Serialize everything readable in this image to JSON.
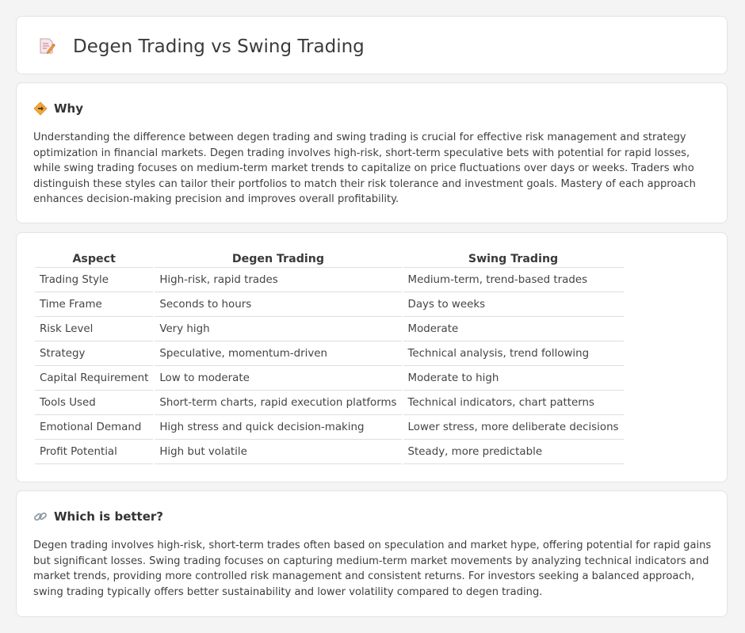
{
  "header": {
    "title": "Degen Trading vs Swing Trading",
    "icon": "memo-pencil-icon"
  },
  "why": {
    "heading": "Why",
    "icon": "warning-diamond-icon",
    "text": "Understanding the difference between degen trading and swing trading is crucial for effective risk management and strategy optimization in financial markets. Degen trading involves high-risk, short-term speculative bets with potential for rapid losses, while swing trading focuses on medium-term market trends to capitalize on price fluctuations over days or weeks. Traders who distinguish these styles can tailor their portfolios to match their risk tolerance and investment goals. Mastery of each approach enhances decision-making precision and improves overall profitability."
  },
  "table": {
    "headers": [
      "Aspect",
      "Degen Trading",
      "Swing Trading"
    ],
    "rows": [
      [
        "Trading Style",
        "High-risk, rapid trades",
        "Medium-term, trend-based trades"
      ],
      [
        "Time Frame",
        "Seconds to hours",
        "Days to weeks"
      ],
      [
        "Risk Level",
        "Very high",
        "Moderate"
      ],
      [
        "Strategy",
        "Speculative, momentum-driven",
        "Technical analysis, trend following"
      ],
      [
        "Capital Requirement",
        "Low to moderate",
        "Moderate to high"
      ],
      [
        "Tools Used",
        "Short-term charts, rapid execution platforms",
        "Technical indicators, chart patterns"
      ],
      [
        "Emotional Demand",
        "High stress and quick decision-making",
        "Lower stress, more deliberate decisions"
      ],
      [
        "Profit Potential",
        "High but volatile",
        "Steady, more predictable"
      ]
    ]
  },
  "better": {
    "heading": "Which is better?",
    "icon": "link-icon",
    "text": "Degen trading involves high-risk, short-term trades often based on speculation and market hype, offering potential for rapid gains but significant losses. Swing trading focuses on capturing medium-term market movements by analyzing technical indicators and market trends, providing more controlled risk management and consistent returns. For investors seeking a balanced approach, swing trading typically offers better sustainability and lower volatility compared to degen trading."
  }
}
